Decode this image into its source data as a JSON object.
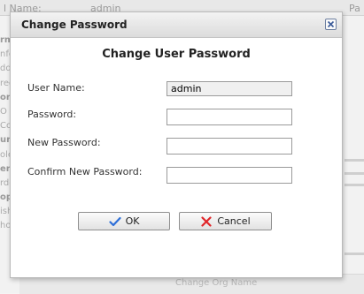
{
  "background": {
    "top_label": "l Name:",
    "top_value": "admin",
    "top_right": "Pa",
    "side_items": [
      "rma",
      "nfo",
      "ddr",
      "red",
      "ont",
      "O",
      "Co",
      "urit",
      "ole",
      "ers",
      "rde",
      "opi",
      "ish",
      "hop"
    ],
    "bottom_text": "Change Org Name"
  },
  "dialog": {
    "title": "Change Password",
    "heading": "Change User Password",
    "fields": {
      "username_label": "User Name:",
      "username_value": "admin",
      "password_label": "Password:",
      "new_password_label": "New Password:",
      "confirm_label": "Confirm New Password:"
    },
    "buttons": {
      "ok": "OK",
      "cancel": "Cancel"
    }
  },
  "icons": {
    "close": "close-icon",
    "ok": "checkmark-icon",
    "cancel": "x-icon"
  },
  "colors": {
    "ok_check": "#2e6fd8",
    "cancel_x": "#e0262a",
    "close_x": "#3b5b9a"
  }
}
